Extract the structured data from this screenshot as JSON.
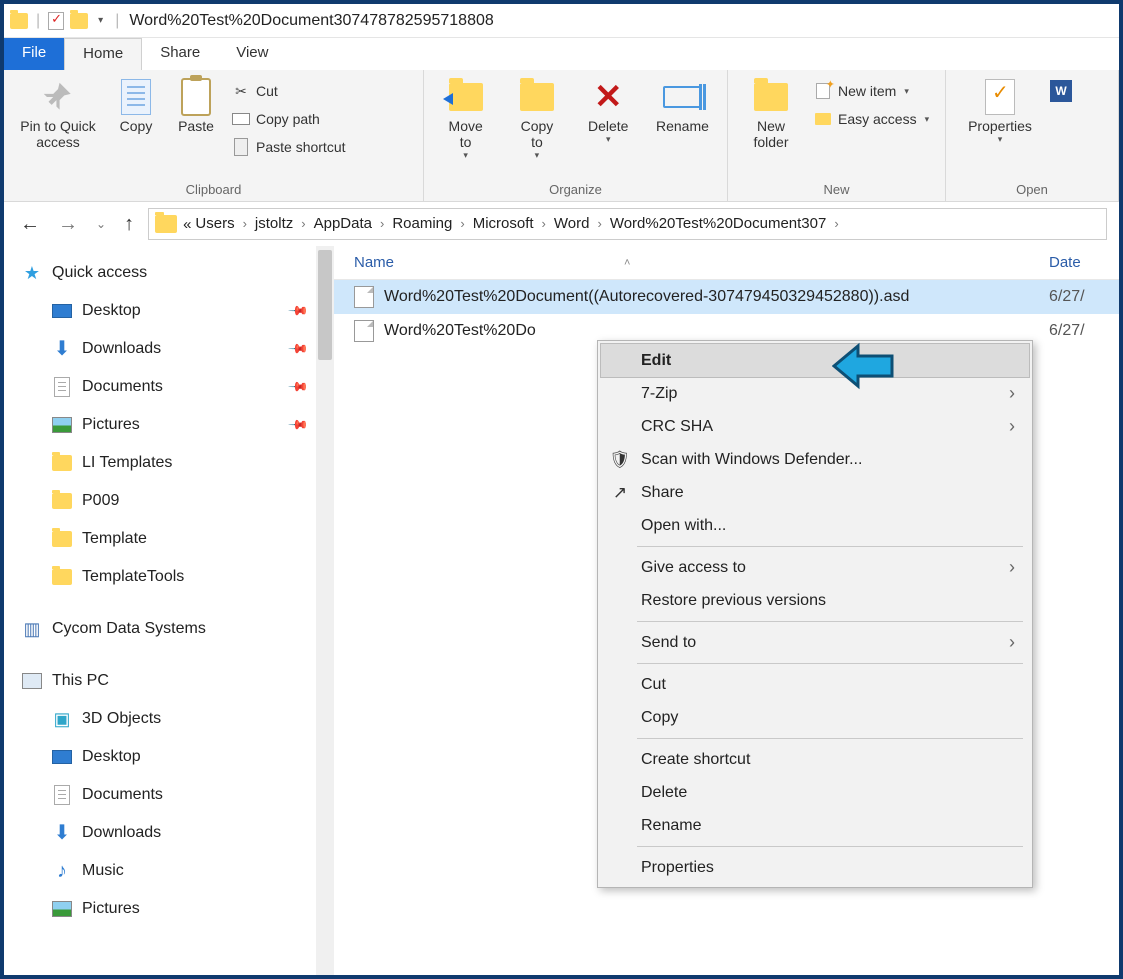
{
  "titlebar": {
    "title": "Word%20Test%20Document307478782595718808"
  },
  "tabs": {
    "file": "File",
    "home": "Home",
    "share": "Share",
    "view": "View"
  },
  "ribbon": {
    "clipboard": {
      "pin": "Pin to Quick\naccess",
      "copy": "Copy",
      "paste": "Paste",
      "cut": "Cut",
      "copypath": "Copy path",
      "pastesc": "Paste shortcut",
      "label": "Clipboard"
    },
    "organize": {
      "moveto": "Move\nto",
      "copyto": "Copy\nto",
      "delete": "Delete",
      "rename": "Rename",
      "label": "Organize"
    },
    "new": {
      "newfolder": "New\nfolder",
      "newitem": "New item",
      "easy": "Easy access",
      "label": "New"
    },
    "open": {
      "props": "Properties",
      "label": "Open"
    }
  },
  "breadcrumb": {
    "prefix": "«",
    "segments": [
      "Users",
      "jstoltz",
      "AppData",
      "Roaming",
      "Microsoft",
      "Word",
      "Word%20Test%20Document307"
    ]
  },
  "columns": {
    "name": "Name",
    "date": "Date"
  },
  "files": [
    {
      "name": "Word%20Test%20Document((Autorecovered-307479450329452880)).asd",
      "date": "6/27/",
      "selected": true
    },
    {
      "name": "Word%20Test%20Do",
      "date": "6/27/",
      "selected": false
    }
  ],
  "sidebar": {
    "quick": "Quick access",
    "items": [
      {
        "label": "Desktop",
        "icon": "desktop",
        "pinned": true
      },
      {
        "label": "Downloads",
        "icon": "down",
        "pinned": true
      },
      {
        "label": "Documents",
        "icon": "doc",
        "pinned": true
      },
      {
        "label": "Pictures",
        "icon": "pic",
        "pinned": true
      },
      {
        "label": "LI Templates",
        "icon": "folder",
        "pinned": false
      },
      {
        "label": "P009",
        "icon": "folder",
        "pinned": false
      },
      {
        "label": "Template",
        "icon": "folder",
        "pinned": false
      },
      {
        "label": "TemplateTools",
        "icon": "folder",
        "pinned": false
      }
    ],
    "cycom": "Cycom Data Systems",
    "thispc": "This PC",
    "pcitems": [
      {
        "label": "3D Objects",
        "icon": "3d"
      },
      {
        "label": "Desktop",
        "icon": "desktop"
      },
      {
        "label": "Documents",
        "icon": "doc"
      },
      {
        "label": "Downloads",
        "icon": "down"
      },
      {
        "label": "Music",
        "icon": "music"
      },
      {
        "label": "Pictures",
        "icon": "pic"
      }
    ]
  },
  "context_menu": [
    {
      "label": "Edit",
      "hovered": true
    },
    {
      "label": "7-Zip",
      "submenu": true
    },
    {
      "label": "CRC SHA",
      "submenu": true
    },
    {
      "label": "Scan with Windows Defender...",
      "icon": "shield"
    },
    {
      "label": "Share",
      "icon": "share"
    },
    {
      "label": "Open with..."
    },
    {
      "sep": true
    },
    {
      "label": "Give access to",
      "submenu": true
    },
    {
      "label": "Restore previous versions"
    },
    {
      "sep": true
    },
    {
      "label": "Send to",
      "submenu": true
    },
    {
      "sep": true
    },
    {
      "label": "Cut"
    },
    {
      "label": "Copy"
    },
    {
      "sep": true
    },
    {
      "label": "Create shortcut"
    },
    {
      "label": "Delete"
    },
    {
      "label": "Rename"
    },
    {
      "sep": true
    },
    {
      "label": "Properties"
    }
  ]
}
